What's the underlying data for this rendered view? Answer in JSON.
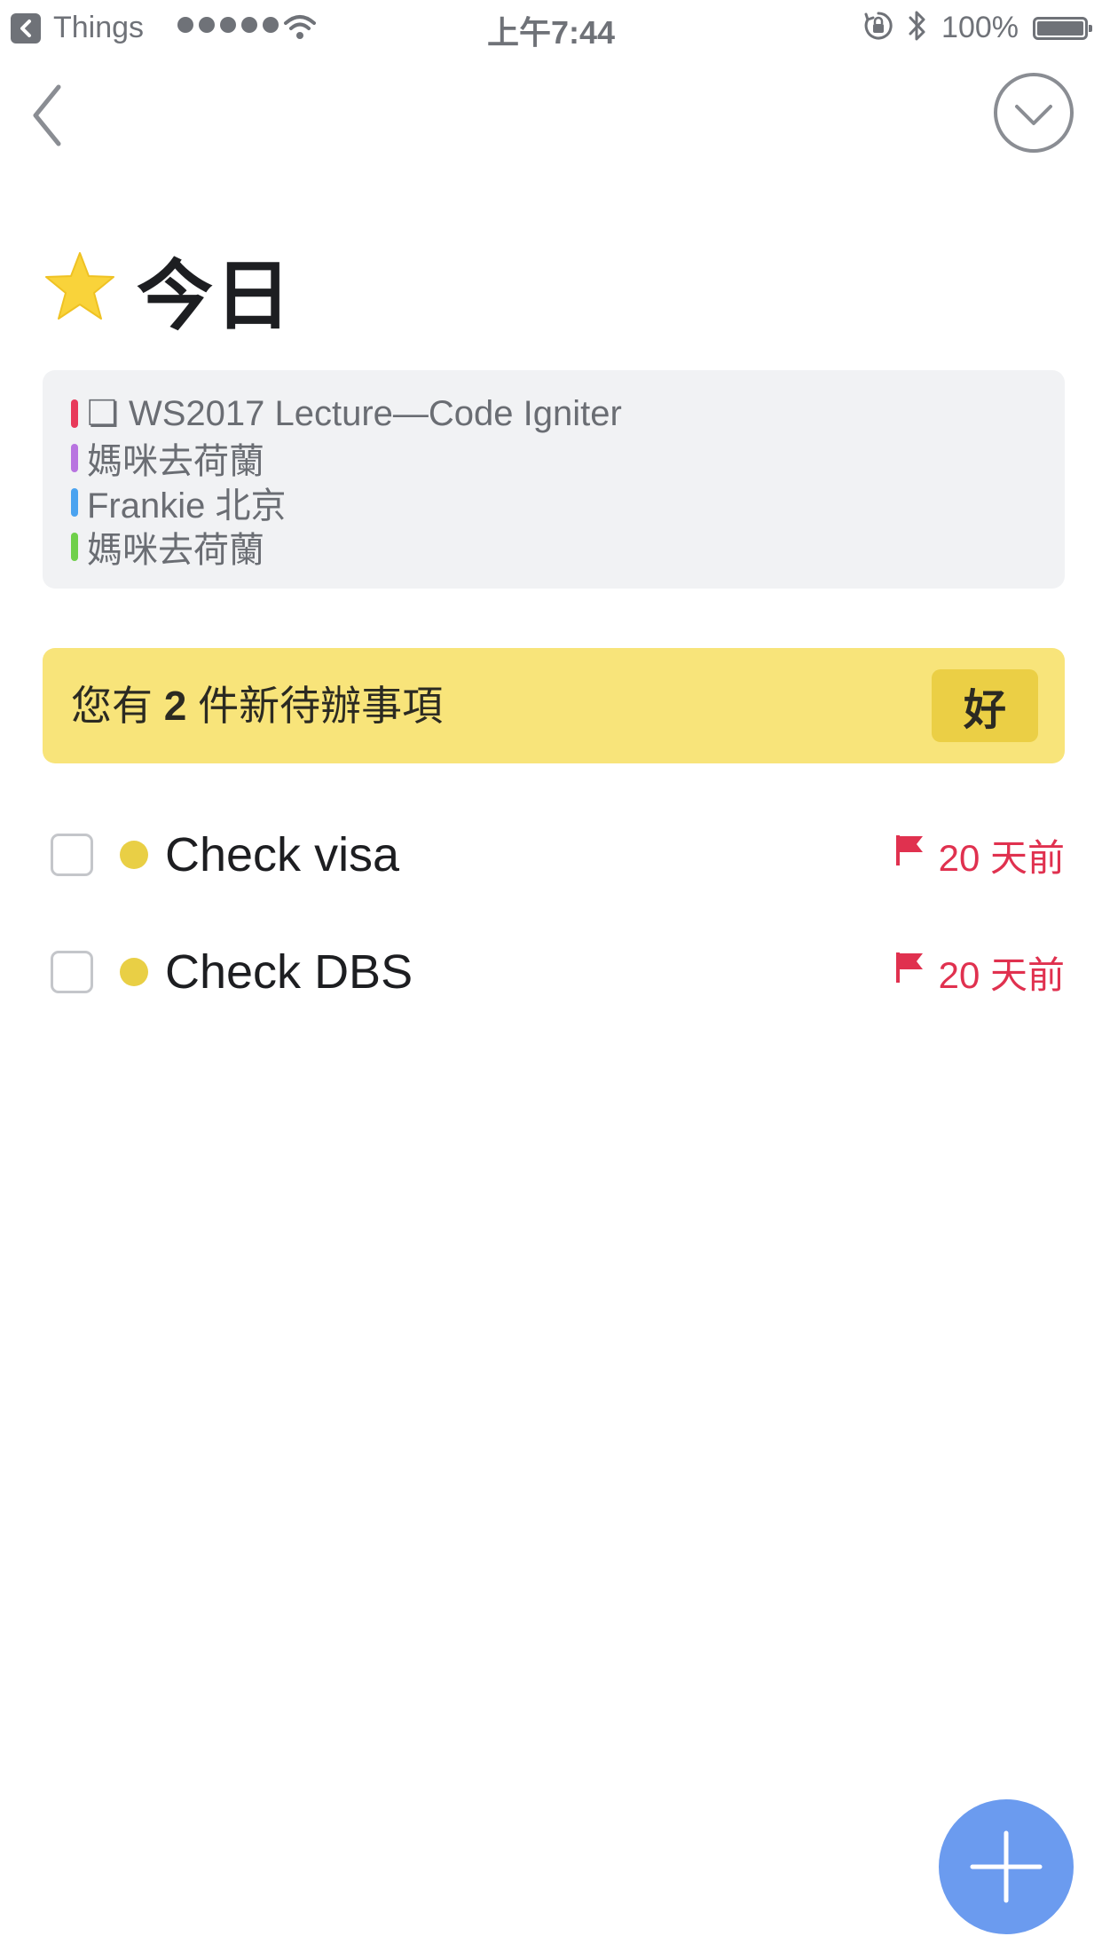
{
  "status_bar": {
    "back_app": "Things",
    "time": "上午7:44",
    "battery": "100%",
    "signal_bars": 5,
    "battery_level": 1.0
  },
  "header": {
    "title": "今日",
    "title_icon": "star-icon"
  },
  "calendar_events": [
    {
      "text": "❏ WS2017 Lecture—Code Igniter",
      "color": "#e8395a"
    },
    {
      "text": "媽咪去荷蘭",
      "color": "#b874e0"
    },
    {
      "text": "Frankie 北京",
      "color": "#4aa3f0"
    },
    {
      "text": "媽咪去荷蘭",
      "color": "#6fd04a"
    }
  ],
  "banner": {
    "prefix": "您有 ",
    "count": "2",
    "suffix": " 件新待辦事項",
    "ok_label": "好"
  },
  "todos": [
    {
      "title": "Check visa",
      "deadline": "20 天前"
    },
    {
      "title": "Check DBS",
      "deadline": "20 天前"
    }
  ],
  "colors": {
    "accent_blue": "#6b9bef",
    "banner_yellow": "#f8e47a",
    "deadline_red": "#e0314f",
    "tag_yellow": "#e9cf45"
  }
}
